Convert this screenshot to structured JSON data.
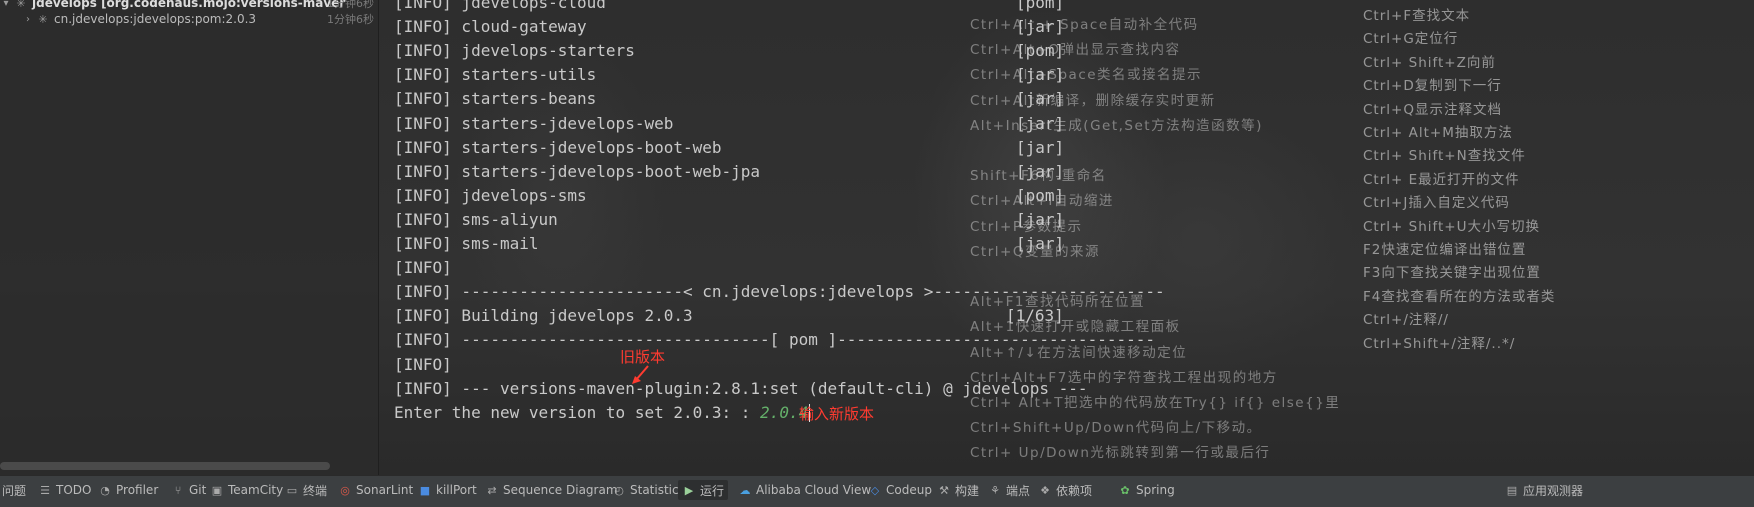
{
  "tree": {
    "items": [
      {
        "label": "jdevelops [org.codehaus.mojo:versions-maver",
        "time": "1分钟6秒"
      },
      {
        "label": "cn.jdevelops:jdevelops:pom:2.0.3",
        "time": "1分钟6秒"
      }
    ]
  },
  "console": {
    "lines": [
      {
        "text": "[INFO] jdevelops-cloud",
        "pkg": "[pom]"
      },
      {
        "text": "[INFO] cloud-gateway",
        "pkg": "[jar]"
      },
      {
        "text": "[INFO] jdevelops-starters",
        "pkg": "[pom]"
      },
      {
        "text": "[INFO] starters-utils",
        "pkg": "[jar]"
      },
      {
        "text": "[INFO] starters-beans",
        "pkg": "[jar]"
      },
      {
        "text": "[INFO] starters-jdevelops-web",
        "pkg": "[jar]"
      },
      {
        "text": "[INFO] starters-jdevelops-boot-web",
        "pkg": "[jar]"
      },
      {
        "text": "[INFO] starters-jdevelops-boot-web-jpa",
        "pkg": "[jar]"
      },
      {
        "text": "[INFO] jdevelops-sms",
        "pkg": "[pom]"
      },
      {
        "text": "[INFO] sms-aliyun",
        "pkg": "[jar]"
      },
      {
        "text": "[INFO] sms-mail",
        "pkg": "[jar]"
      },
      {
        "text": "[INFO]",
        "pkg": ""
      },
      {
        "text": "[INFO] -----------------------< cn.jdevelops:jdevelops >------------------------",
        "pkg": ""
      },
      {
        "text": "[INFO] Building jdevelops 2.0.3",
        "pkg": "[1/63]"
      },
      {
        "text": "[INFO] --------------------------------[ pom ]---------------------------------",
        "pkg": ""
      },
      {
        "text": "[INFO]",
        "pkg": ""
      },
      {
        "text": "[INFO] --- versions-maven-plugin:2.8.1:set (default-cli) @ jdevelops ---",
        "pkg": ""
      }
    ],
    "prompt": "Enter the new version to set 2.0.3: : ",
    "prompt_input": "2.0.4"
  },
  "annotations": {
    "old_version": "旧版本",
    "new_version": "输入新版本"
  },
  "shortcuts_left": [
    "Ctrl+Alt + Space自动补全代码",
    "Ctrl+Alt+O弹出显示查找内容",
    "Ctrl+Alt+Space类名或接名提示",
    "Ctrl+Alt新编译，删除缓存实时更新",
    "Alt+Insert生成(Get,Set方法构造函数等)",
    "",
    "Shift+F6构-重命名",
    "Ctrl+Alt+I自动缩进",
    "Ctrl+P参数提示",
    "Ctrl+Q变量的来源",
    "",
    "Alt+F1查找代码所在位置",
    "Alt+1快速打开或隐藏工程面板",
    "Alt+↑/↓在方法间快速移动定位",
    "Ctrl+Alt+F7选中的字符查找工程出现的地方",
    "Ctrl+ Alt+T把选中的代码放在Try{} if{} else{}里",
    "Ctrl+Shift+Up/Down代码向上/下移动。",
    "Ctrl+ Up/Down光标跳转到第一行或最后行"
  ],
  "shortcuts_right": [
    "Ctrl+F查找文本",
    "Ctrl+G定位行",
    "Ctrl+ Shift+Z向前",
    "Ctrl+D复制到下一行",
    "Ctrl+Q显示注释文档",
    "Ctrl+ Alt+M抽取方法",
    "Ctrl+ Shift+N查找文件",
    "Ctrl+ E最近打开的文件",
    "Ctrl+J插入自定义代码",
    "Ctrl+ Shift+U大小写切换",
    "F2快速定位编译出错位置",
    "F3向下查找关键字出现位置",
    "F4查找查看所在的方法或者类",
    "Ctrl+/注释//",
    "Ctrl+Shift+/注释/..*/"
  ],
  "toolbar": {
    "items": [
      {
        "label": "问题",
        "icon": ""
      },
      {
        "label": "TODO",
        "icon": "list-icon"
      },
      {
        "label": "Profiler",
        "icon": "profiler-icon"
      },
      {
        "label": "Git",
        "icon": "branch-icon"
      },
      {
        "label": "TeamCity",
        "icon": "teamcity-icon"
      },
      {
        "label": "终端",
        "icon": "terminal-icon"
      },
      {
        "label": "SonarLint",
        "icon": "sonarlint-icon"
      },
      {
        "label": "killPort",
        "icon": "killport-icon"
      },
      {
        "label": "Sequence Diagram",
        "icon": "sequence-icon"
      },
      {
        "label": "Statistic",
        "icon": "statistic-icon"
      },
      {
        "label": "运行",
        "icon": "run-icon"
      },
      {
        "label": "Alibaba Cloud View",
        "icon": "cloud-icon"
      },
      {
        "label": "Codeup",
        "icon": "codeup-icon"
      },
      {
        "label": "构建",
        "icon": "hammer-icon"
      },
      {
        "label": "端点",
        "icon": "endpoints-icon"
      },
      {
        "label": "依赖项",
        "icon": "dependencies-icon"
      },
      {
        "label": "Spring",
        "icon": "spring-icon"
      },
      {
        "label": "应用观测器",
        "icon": "observer-icon"
      }
    ]
  },
  "colors": {
    "annotation": "#ff3b30",
    "prompt_input": "#64b06a",
    "console_text": "#c9c9c9"
  }
}
